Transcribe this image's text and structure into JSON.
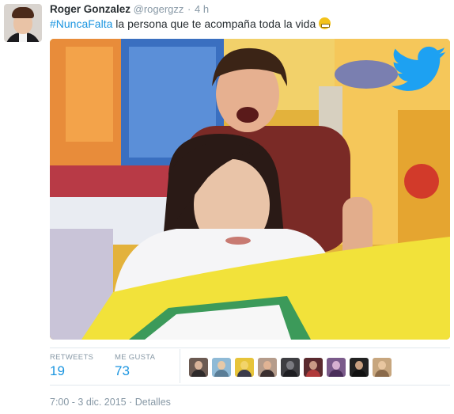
{
  "tweet": {
    "author_name": "Roger Gonzalez",
    "author_handle": "@rogergzz",
    "separator": "·",
    "time_ago": "4 h",
    "hashtag": "#NuncaFalta",
    "body": " la persona que te acompaña toda la vida",
    "emoji": "grimacing-face",
    "photo_logo": "twitter-bird-icon"
  },
  "stats": {
    "retweets_label": "RETWEETS",
    "retweets_count": "19",
    "likes_label": "ME GUSTA",
    "likes_count": "73"
  },
  "favoriters": [
    {
      "name": "favoriter-1",
      "bg": "#6b5a52",
      "face": "#d8b39a",
      "body": "#2e2a2a"
    },
    {
      "name": "favoriter-2",
      "bg": "#8fbad6",
      "face": "#e6c9a8",
      "body": "#5a7d96"
    },
    {
      "name": "favoriter-3",
      "bg": "#e7c43a",
      "face": "#f2d46a",
      "body": "#3a3a4a"
    },
    {
      "name": "favoriter-4",
      "bg": "#b59c8b",
      "face": "#e0b394",
      "body": "#3b2f2f"
    },
    {
      "name": "favoriter-5",
      "bg": "#3e3e42",
      "face": "#7a7a80",
      "body": "#1e1e22"
    },
    {
      "name": "favoriter-6",
      "bg": "#5a2a2e",
      "face": "#c99a86",
      "body": "#b03a3a"
    },
    {
      "name": "favoriter-7",
      "bg": "#7a5a8a",
      "face": "#d6b0d0",
      "body": "#4a2e5a"
    },
    {
      "name": "favoriter-8",
      "bg": "#222222",
      "face": "#c8a080",
      "body": "#111111"
    },
    {
      "name": "favoriter-9",
      "bg": "#c7a67e",
      "face": "#e8c6a0",
      "body": "#8a6a4a"
    }
  ],
  "footer": {
    "datetime": "7:00 - 3 dic. 2015",
    "separator": "·",
    "details_link": "Detalles"
  },
  "colors": {
    "link_blue": "#1b95e0",
    "muted_gray": "#8899a6",
    "text": "#292f33",
    "twitter_bird": "#1da1f2"
  }
}
